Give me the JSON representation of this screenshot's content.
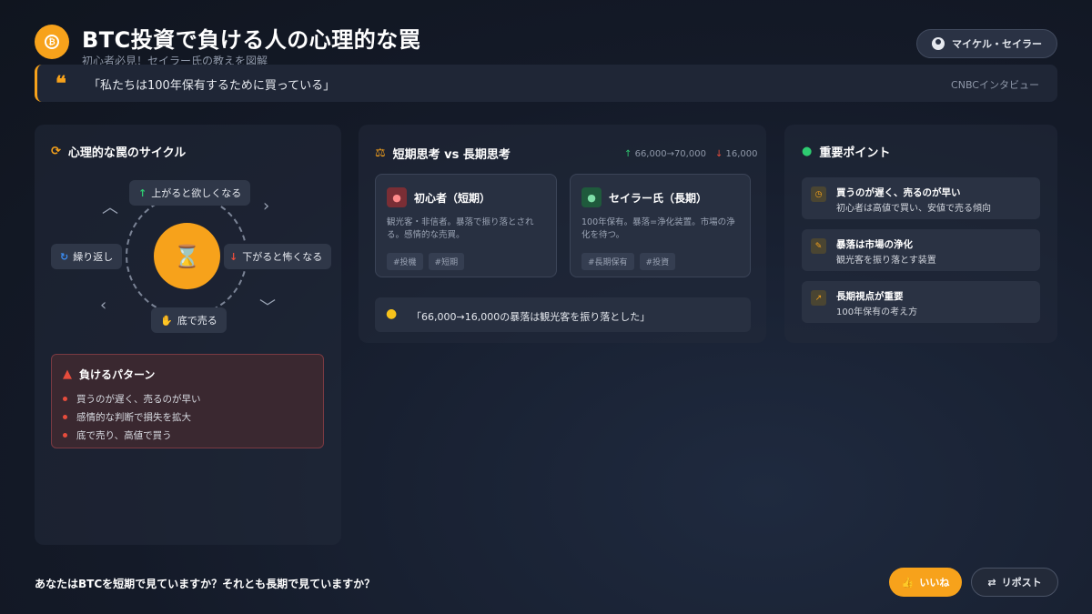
{
  "header": {
    "title": "BTC投資で負ける人の心理的な罠",
    "subtitle": "初心者必見！セイラー氏の教えを図解",
    "user_button": "マイケル・セイラー",
    "logo_icon": "bitcoin-icon"
  },
  "quote": {
    "mark": "❝",
    "text": "「私たちは100年保有するために買っている」",
    "source": "CNBCインタビュー"
  },
  "cycle_panel": {
    "title": "心理的な罠のサイクル",
    "center_glyph": "⌛",
    "steps": {
      "up": "上がると欲しくなる",
      "down": "下がると怖くなる",
      "sell": "底で売る",
      "repeat": "繰り返し"
    },
    "lose_pattern": {
      "title": "負けるパターン",
      "items": [
        "買うのが遅く、売るのが早い",
        "感情的な判断で損失を拡大",
        "底で売り、高値で買う"
      ]
    }
  },
  "compare_panel": {
    "title": "短期思考 vs 長期思考",
    "stat_up": "66,000→70,000",
    "stat_down": "16,000",
    "cards": [
      {
        "title": "初心者（短期）",
        "desc": "観光客・非信者。暴落で振り落とされる。感情的な売買。",
        "tags": [
          "#投機",
          "#短期"
        ]
      },
      {
        "title": "セイラー氏（長期）",
        "desc": "100年保有。暴落=浄化装置。市場の浄化を待つ。",
        "tags": [
          "#長期保有",
          "#投資"
        ]
      }
    ],
    "tip": "「66,000→16,000の暴落は観光客を振り落とした」"
  },
  "key_points": {
    "title": "重要ポイント",
    "items": [
      {
        "title": "買うのが遅く、売るのが早い",
        "sub": "初心者は高値で買い、安値で売る傾向"
      },
      {
        "title": "暴落は市場の浄化",
        "sub": "観光客を振り落とす装置"
      },
      {
        "title": "長期視点が重要",
        "sub": "100年保有の考え方"
      }
    ]
  },
  "footer": {
    "question": "あなたはBTCを短期で見ていますか？それとも長期で見ていますか？",
    "like": "いいね",
    "repost": "リポスト"
  },
  "colors": {
    "accent": "#f7a21b",
    "danger": "#e74c3c",
    "success": "#2ecc71"
  }
}
